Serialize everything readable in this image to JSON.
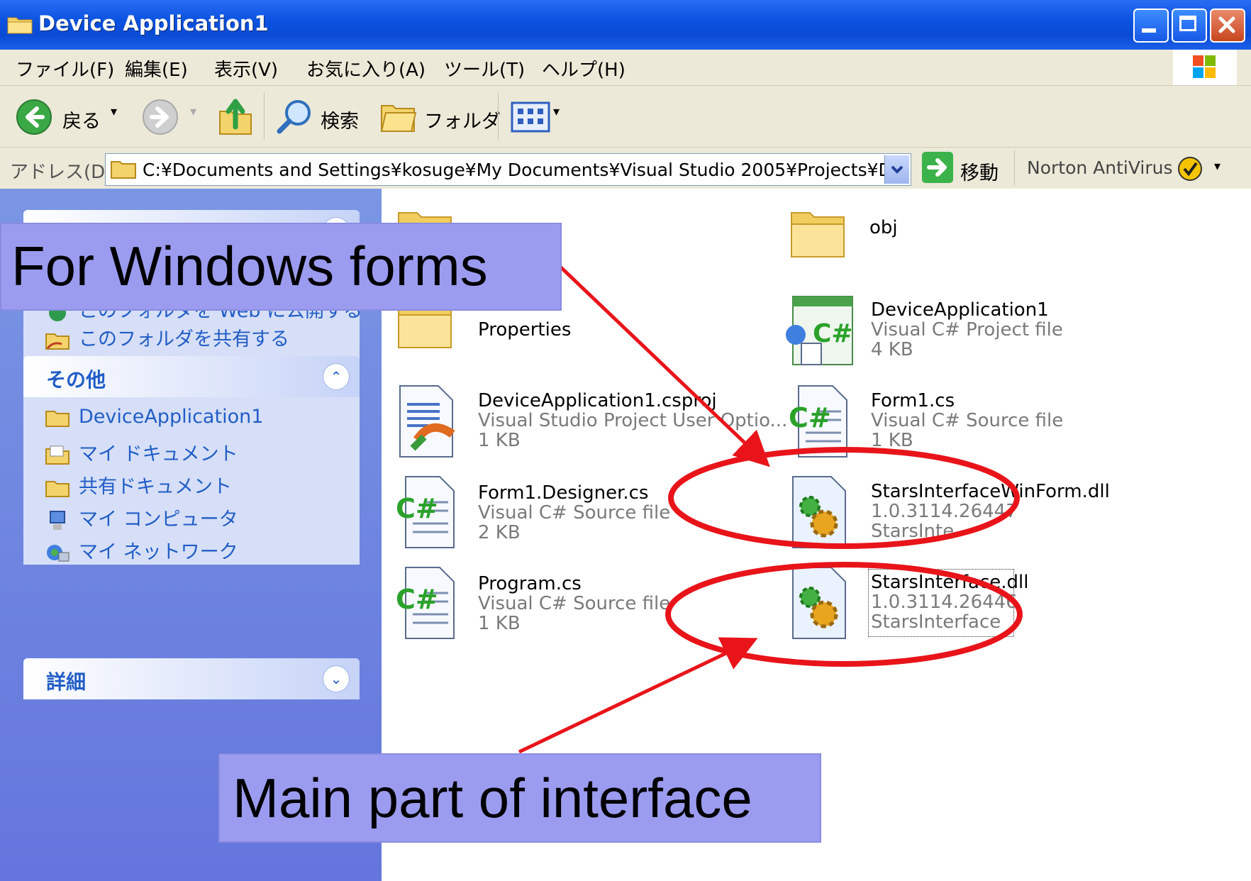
{
  "window": {
    "title": "Device Application1"
  },
  "menu": [
    "ファイル(F)",
    "編集(E)",
    "表示(V)",
    "お気に入り(A)",
    "ツール(T)",
    "ヘルプ(H)"
  ],
  "toolbar": {
    "back_label": "戻る",
    "search_label": "検索",
    "folders_label": "フォルダ"
  },
  "address": {
    "label": "アドレス(D)",
    "path": "C:¥Documents and Settings¥kosuge¥My Documents¥Visual Studio 2005¥Projects¥Devic",
    "go_label": "移動",
    "norton_label": "Norton AntiVirus"
  },
  "tasks_panel": {
    "items": [
      "このフォルダを Web に公開する",
      "このフォルダを共有する"
    ]
  },
  "other_panel": {
    "title": "その他",
    "items": [
      "DeviceApplication1",
      "マイ ドキュメント",
      "共有ドキュメント",
      "マイ コンピュータ",
      "マイ ネットワーク"
    ]
  },
  "details_panel": {
    "title": "詳細"
  },
  "files": [
    {
      "name": "",
      "line2": "",
      "line3": ""
    },
    {
      "name": "obj",
      "line2": "",
      "line3": ""
    },
    {
      "name": "Properties",
      "line2": "",
      "line3": ""
    },
    {
      "name": "DeviceApplication1",
      "line2": "Visual C# Project file",
      "line3": "4 KB"
    },
    {
      "name": "DeviceApplication1.csproj",
      "line2": "Visual Studio Project User Optio...",
      "line3": "1 KB"
    },
    {
      "name": "Form1.cs",
      "line2": "Visual C# Source file",
      "line3": "1 KB"
    },
    {
      "name": "Form1.Designer.cs",
      "line2": "Visual C# Source file",
      "line3": "2 KB"
    },
    {
      "name": "StarsInterfaceWinForm.dll",
      "line2": "1.0.3114.26447",
      "line3": "StarsInterfaceWinForm"
    },
    {
      "name": "Program.cs",
      "line2": "Visual C# Source file",
      "line3": "1 KB"
    },
    {
      "name": "StarsInterface.dll",
      "line2": "1.0.3114.26446",
      "line3": "StarsInterface"
    }
  ],
  "annotations": {
    "top": "For Windows forms",
    "bottom": "Main part of interface"
  },
  "colors": {
    "title_blue": "#0a4bd4",
    "pane_blue": "#6f86df",
    "annotation_red": "#e8141a",
    "callout_fill": "#9b9cf0"
  }
}
